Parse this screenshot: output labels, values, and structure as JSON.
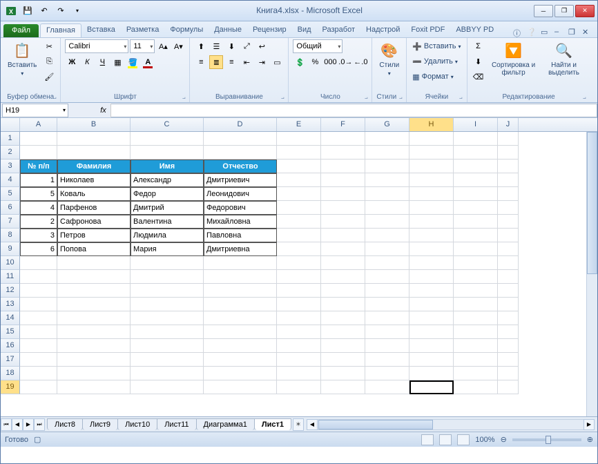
{
  "title": "Книга4.xlsx  -  Microsoft Excel",
  "tabs": {
    "file": "Файл",
    "items": [
      "Главная",
      "Вставка",
      "Разметка",
      "Формулы",
      "Данные",
      "Рецензир",
      "Вид",
      "Разработ",
      "Надстрой",
      "Foxit PDF",
      "ABBYY PD"
    ],
    "active": 0
  },
  "ribbon": {
    "clipboard": {
      "label": "Буфер обмена",
      "paste": "Вставить"
    },
    "font": {
      "label": "Шрифт",
      "name": "Calibri",
      "size": "11"
    },
    "align": {
      "label": "Выравнивание"
    },
    "number": {
      "label": "Число",
      "format": "Общий"
    },
    "styles": {
      "label": "Стили",
      "btn": "Стили"
    },
    "cells": {
      "label": "Ячейки",
      "insert": "Вставить",
      "delete": "Удалить",
      "format": "Формат"
    },
    "editing": {
      "label": "Редактирование",
      "sort": "Сортировка и фильтр",
      "find": "Найти и выделить"
    }
  },
  "namebox": "H19",
  "fx": "fx",
  "columns": [
    "A",
    "B",
    "C",
    "D",
    "E",
    "F",
    "G",
    "H",
    "I",
    "J"
  ],
  "selected_col": 7,
  "selected_row": 19,
  "table": {
    "header_row": 3,
    "headers": [
      "№ п/п",
      "Фамилия",
      "Имя",
      "Отчество"
    ],
    "rows": [
      {
        "n": "1",
        "f": "Николаев",
        "i": "Александр",
        "o": "Дмитриевич"
      },
      {
        "n": "5",
        "f": "Коваль",
        "i": "Федор",
        "o": "Леонидович"
      },
      {
        "n": "4",
        "f": "Парфенов",
        "i": "Дмитрий",
        "o": "Федорович"
      },
      {
        "n": "2",
        "f": "Сафронова",
        "i": "Валентина",
        "o": "Михайловна"
      },
      {
        "n": "3",
        "f": "Петров",
        "i": "Людмила",
        "o": "Павловна"
      },
      {
        "n": "6",
        "f": "Попова",
        "i": "Мария",
        "o": "Дмитриевна"
      }
    ]
  },
  "sheets": {
    "items": [
      "Лист8",
      "Лист9",
      "Лист10",
      "Лист11",
      "Диаграмма1",
      "Лист1"
    ],
    "active": 5
  },
  "status": {
    "ready": "Готово",
    "zoom": "100%"
  }
}
